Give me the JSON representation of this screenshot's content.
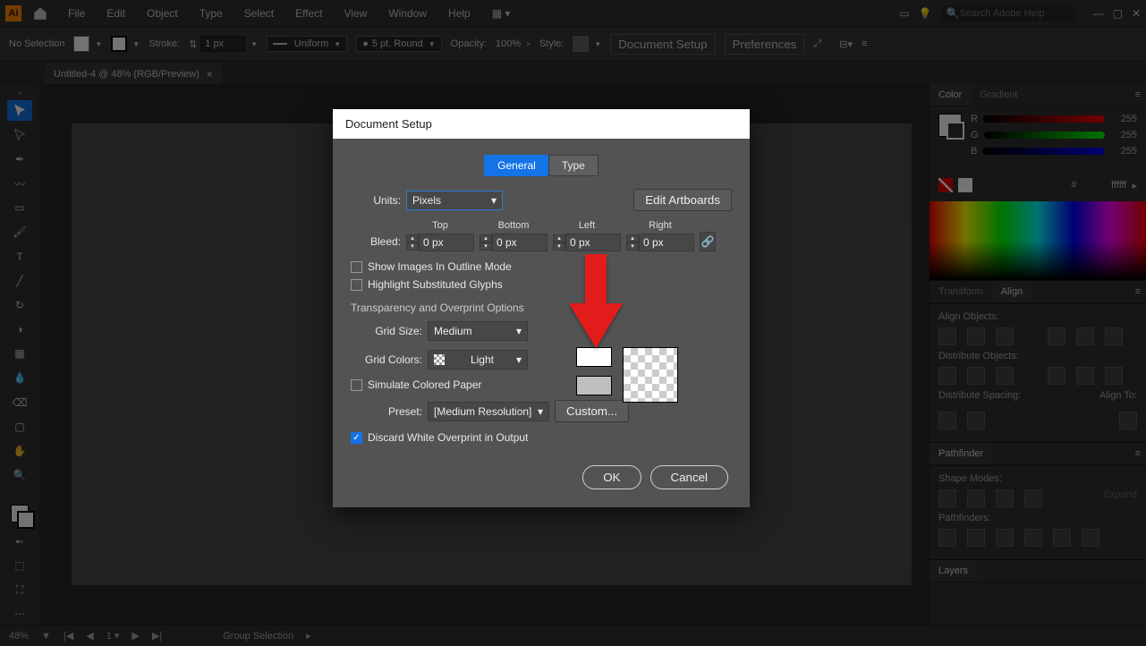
{
  "menu": {
    "items": [
      "File",
      "Edit",
      "Object",
      "Type",
      "Select",
      "Effect",
      "View",
      "Window",
      "Help"
    ],
    "search_placeholder": "Search Adobe Help"
  },
  "controlbar": {
    "selection": "No Selection",
    "stroke_label": "Stroke:",
    "stroke_value": "1 px",
    "profile": "Uniform",
    "point": "5 pt. Round",
    "opacity_label": "Opacity:",
    "opacity_value": "100%",
    "style_label": "Style:",
    "doc_setup": "Document Setup",
    "preferences": "Preferences"
  },
  "tab": {
    "title": "Untitled-4 @ 48% (RGB/Preview)"
  },
  "statusbar": {
    "zoom": "48%",
    "mode": "Group Selection"
  },
  "panels": {
    "color": {
      "tab1": "Color",
      "tab2": "Gradient",
      "r": "255",
      "g": "255",
      "b": "255",
      "hex": "ffffff"
    },
    "transform": {
      "tab1": "Transform",
      "tab2": "Align"
    },
    "align": {
      "sec1": "Align Objects:",
      "sec2": "Distribute Objects:",
      "sec3": "Distribute Spacing:",
      "sec4": "Align To:"
    },
    "pathfinder": {
      "title": "Pathfinder",
      "shape": "Shape Modes:",
      "expand": "Expand",
      "pf": "Pathfinders:"
    },
    "layers": {
      "title": "Layers"
    }
  },
  "dialog": {
    "title": "Document Setup",
    "tabs": {
      "general": "General",
      "type": "Type"
    },
    "units_label": "Units:",
    "units_value": "Pixels",
    "edit_artboards": "Edit Artboards",
    "bleed_label": "Bleed:",
    "bleed": {
      "top": "Top",
      "bottom": "Bottom",
      "left": "Left",
      "right": "Right",
      "value": "0 px"
    },
    "show_images": "Show Images In Outline Mode",
    "highlight_glyphs": "Highlight Substituted Glyphs",
    "transparency_head": "Transparency and Overprint Options",
    "grid_size_label": "Grid Size:",
    "grid_size_value": "Medium",
    "grid_colors_label": "Grid Colors:",
    "grid_colors_value": "Light",
    "simulate_paper": "Simulate Colored Paper",
    "preset_label": "Preset:",
    "preset_value": "[Medium Resolution]",
    "custom": "Custom...",
    "discard_white": "Discard White Overprint in Output",
    "ok": "OK",
    "cancel": "Cancel"
  }
}
